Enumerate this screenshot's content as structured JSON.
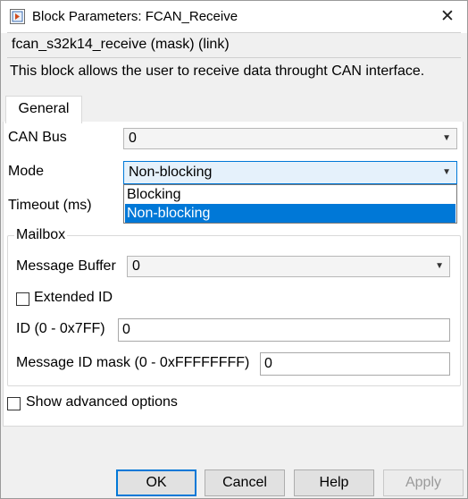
{
  "window": {
    "title": "Block Parameters: FCAN_Receive",
    "close_glyph": "✕"
  },
  "header": {
    "mask_name": "fcan_s32k14_receive (mask) (link)",
    "description": "This block allows the user to receive data throught CAN interface."
  },
  "tabs": [
    {
      "label": "General",
      "active": true
    }
  ],
  "params": {
    "can_bus": {
      "label": "CAN Bus",
      "value": "0"
    },
    "mode": {
      "label": "Mode",
      "value": "Non-blocking",
      "options": [
        "Blocking",
        "Non-blocking"
      ],
      "selected_option": "Non-blocking"
    },
    "timeout": {
      "label": "Timeout (ms)"
    },
    "mailbox": {
      "legend": "Mailbox",
      "message_buffer": {
        "label": "Message Buffer",
        "value": "0"
      },
      "extended_id": {
        "label": "Extended ID",
        "checked": false
      },
      "id": {
        "label": "ID (0 - 0x7FF)",
        "value": "0"
      },
      "id_mask": {
        "label": "Message ID mask (0 - 0xFFFFFFFF)",
        "value": "0"
      }
    },
    "show_advanced": {
      "label": "Show advanced options",
      "checked": false
    }
  },
  "buttons": {
    "ok": "OK",
    "cancel": "Cancel",
    "help": "Help",
    "apply": "Apply"
  },
  "icons": {
    "dropdown_arrow": "▼"
  },
  "colors": {
    "accent": "#0078d7",
    "selection": "#0078d7",
    "active_combo_bg": "#e5f1fb"
  }
}
